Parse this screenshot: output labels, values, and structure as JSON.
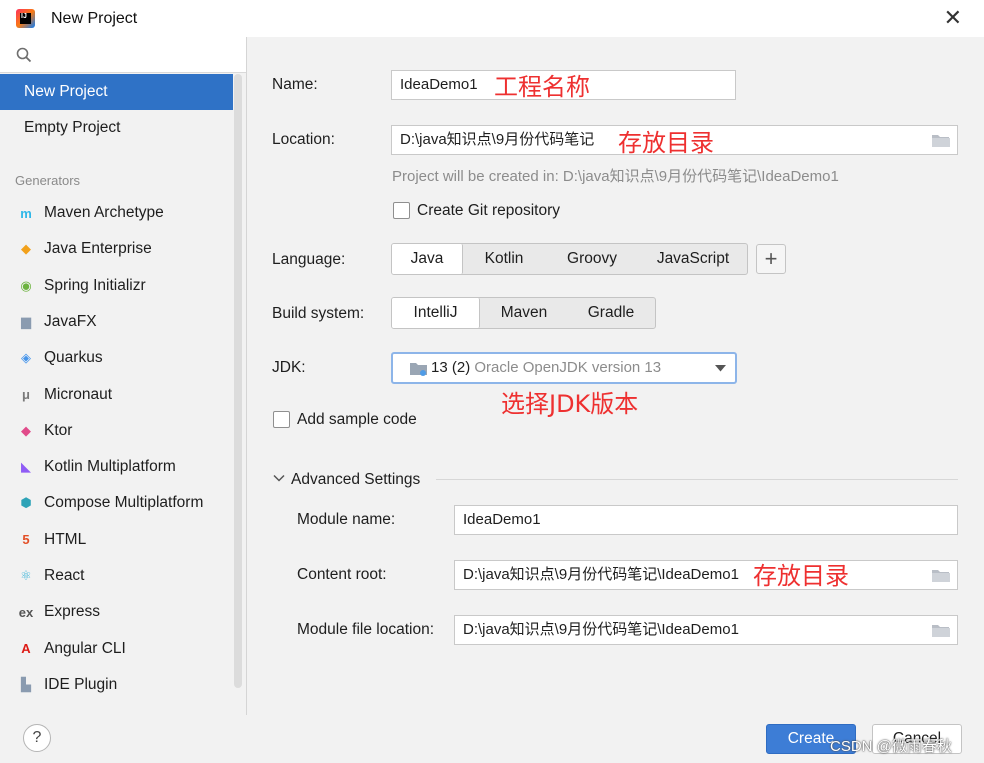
{
  "window": {
    "title": "New Project",
    "close": "✕"
  },
  "sidebar": {
    "search_placeholder": "",
    "nav": [
      {
        "label": "New Project",
        "selected": true
      },
      {
        "label": "Empty Project",
        "selected": false
      }
    ],
    "generators_label": "Generators",
    "generators": [
      {
        "label": "Maven Archetype",
        "icon": "maven-icon",
        "glyph": "m",
        "color": "#2fb7e8"
      },
      {
        "label": "Java Enterprise",
        "icon": "java-enterprise-icon",
        "glyph": "◆",
        "color": "#f2a11b"
      },
      {
        "label": "Spring Initializr",
        "icon": "spring-icon",
        "glyph": "◉",
        "color": "#6db33f"
      },
      {
        "label": "JavaFX",
        "icon": "javafx-folder-icon",
        "glyph": "▆",
        "color": "#8a9bb0"
      },
      {
        "label": "Quarkus",
        "icon": "quarkus-icon",
        "glyph": "◈",
        "color": "#4695eb"
      },
      {
        "label": "Micronaut",
        "icon": "micronaut-icon",
        "glyph": "μ",
        "color": "#7a7a7a"
      },
      {
        "label": "Ktor",
        "icon": "ktor-icon",
        "glyph": "◆",
        "color": "#e14b8a"
      },
      {
        "label": "Kotlin Multiplatform",
        "icon": "kotlin-icon",
        "glyph": "◣",
        "color": "#8f5cf5"
      },
      {
        "label": "Compose Multiplatform",
        "icon": "compose-icon",
        "glyph": "⬢",
        "color": "#2ea3b7"
      },
      {
        "label": "HTML",
        "icon": "html5-icon",
        "glyph": "5",
        "color": "#e34f26"
      },
      {
        "label": "React",
        "icon": "react-icon",
        "glyph": "⚛",
        "color": "#3fb6d9"
      },
      {
        "label": "Express",
        "icon": "express-icon",
        "glyph": "ex",
        "color": "#555555"
      },
      {
        "label": "Angular CLI",
        "icon": "angular-icon",
        "glyph": "A",
        "color": "#dd1b16"
      },
      {
        "label": "IDE Plugin",
        "icon": "ide-plugin-icon",
        "glyph": "▙",
        "color": "#8a9bb0"
      }
    ]
  },
  "form": {
    "name_label": "Name:",
    "name_value": "IdeaDemo1",
    "location_label": "Location:",
    "location_value": "D:\\java知识点\\9月份代码笔记",
    "created_hint": "Project will be created in: D:\\java知识点\\9月份代码笔记\\IdeaDemo1",
    "git_label": "Create Git repository",
    "language_label": "Language:",
    "languages": [
      "Java",
      "Kotlin",
      "Groovy",
      "JavaScript"
    ],
    "language_selected": "Java",
    "add_language": "+",
    "build_label": "Build system:",
    "build_systems": [
      "IntelliJ",
      "Maven",
      "Gradle"
    ],
    "build_selected": "IntelliJ",
    "jdk_label": "JDK:",
    "jdk_value": "13 (2)",
    "jdk_detail": "Oracle OpenJDK version 13",
    "sample_label": "Add sample code",
    "advanced_label": "Advanced Settings",
    "module_name_label": "Module name:",
    "module_name_value": "IdeaDemo1",
    "content_root_label": "Content root:",
    "content_root_value": "D:\\java知识点\\9月份代码笔记\\IdeaDemo1",
    "module_file_label": "Module file location:",
    "module_file_value": "D:\\java知识点\\9月份代码笔记\\IdeaDemo1"
  },
  "annotations": {
    "name_note": "工程名称",
    "location_note": "存放目录",
    "jdk_note": "选择JDK版本",
    "content_root_note": "存放目录"
  },
  "footer": {
    "help": "?",
    "create": "Create",
    "cancel": "Cancel",
    "watermark": "CSDN @微雨春秋"
  },
  "colors": {
    "accent": "#2f72c6",
    "annotation": "#ee3030",
    "focus_border": "#8db5e9"
  }
}
